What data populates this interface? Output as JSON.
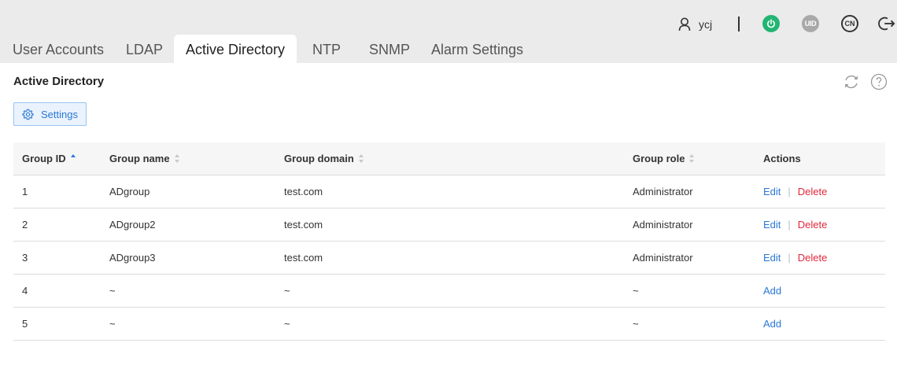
{
  "header": {
    "username": "ycj",
    "uid_label": "UID",
    "lang_label": "CN",
    "icons": [
      "user-icon",
      "power-icon",
      "uid-icon",
      "language-icon",
      "logout-icon"
    ],
    "colors": {
      "power": "#22b573",
      "uid": "#a9a9a9"
    }
  },
  "tabs": [
    {
      "label": "User Accounts"
    },
    {
      "label": "LDAP"
    },
    {
      "label": "Active Directory",
      "active": true
    },
    {
      "label": "NTP"
    },
    {
      "label": "SNMP"
    },
    {
      "label": "Alarm Settings"
    }
  ],
  "page": {
    "title": "Active Directory",
    "settings_label": "Settings"
  },
  "table": {
    "columns": [
      "Group ID",
      "Group name",
      "Group domain",
      "Group role",
      "Actions"
    ],
    "rows": [
      {
        "id": "1",
        "name": "ADgroup",
        "domain": "test.com",
        "role": "Administrator",
        "actions": [
          "Edit",
          "Delete"
        ]
      },
      {
        "id": "2",
        "name": "ADgroup2",
        "domain": "test.com",
        "role": "Administrator",
        "actions": [
          "Edit",
          "Delete"
        ]
      },
      {
        "id": "3",
        "name": "ADgroup3",
        "domain": "test.com",
        "role": "Administrator",
        "actions": [
          "Edit",
          "Delete"
        ]
      },
      {
        "id": "4",
        "name": "~",
        "domain": "~",
        "role": "~",
        "actions": [
          "Add"
        ]
      },
      {
        "id": "5",
        "name": "~",
        "domain": "~",
        "role": "~",
        "actions": [
          "Add"
        ]
      }
    ]
  },
  "colors": {
    "accent": "#2a78d6",
    "danger": "#e0283c"
  }
}
